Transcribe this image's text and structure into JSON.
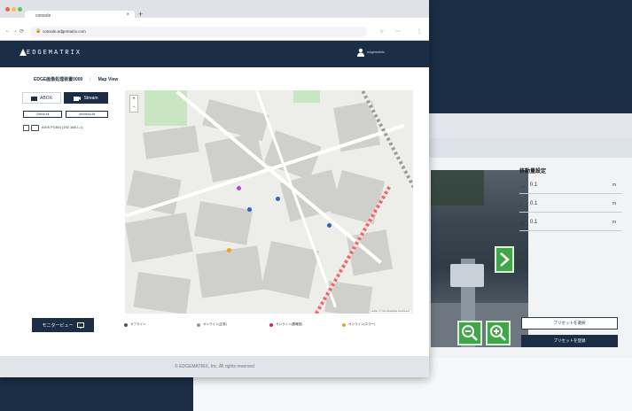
{
  "browser": {
    "tab_title": "console",
    "url": "console.edgematrix.com",
    "new_tab": "+"
  },
  "header": {
    "logo": "EDGEMATRIX",
    "user": "edgematrix"
  },
  "breadcrumb": {
    "device": "EDGE画像処理装置0000",
    "current": "Map View"
  },
  "sidebar": {
    "abox_label": "ABOX",
    "stream_label": "Stream",
    "check_all": "Check All",
    "uncheck_all": "Uncheck All",
    "device_item": "AXIS P1364 (192.168.1.1)"
  },
  "map": {
    "zoom_in": "+",
    "zoom_out": "−",
    "attribution": "Leaflet | © OpenStreetMap contributors"
  },
  "monitor_button": "モニタービュー",
  "legend": [
    {
      "label": "オフライン",
      "color": "#555555"
    },
    {
      "label": "オンライン(正常)",
      "color": "#8a96a2"
    },
    {
      "label": "オンライン(要確認)",
      "color": "#d1245a"
    },
    {
      "label": "オンライン(エラー)",
      "color": "#f2a21a"
    }
  ],
  "footer": "© EDGEMATRIX, Inc. All rights reserved",
  "back_panel": {
    "title": "移動量設定",
    "rows": [
      {
        "icon": "↔",
        "value": "0.1",
        "unit": "m"
      },
      {
        "icon": "↕",
        "value": "0.1",
        "unit": "m"
      },
      {
        "icon": "⟲",
        "value": "0.1",
        "unit": "m"
      }
    ],
    "btn_select": "プリセットを選択",
    "btn_register": "プリセットを登録"
  }
}
